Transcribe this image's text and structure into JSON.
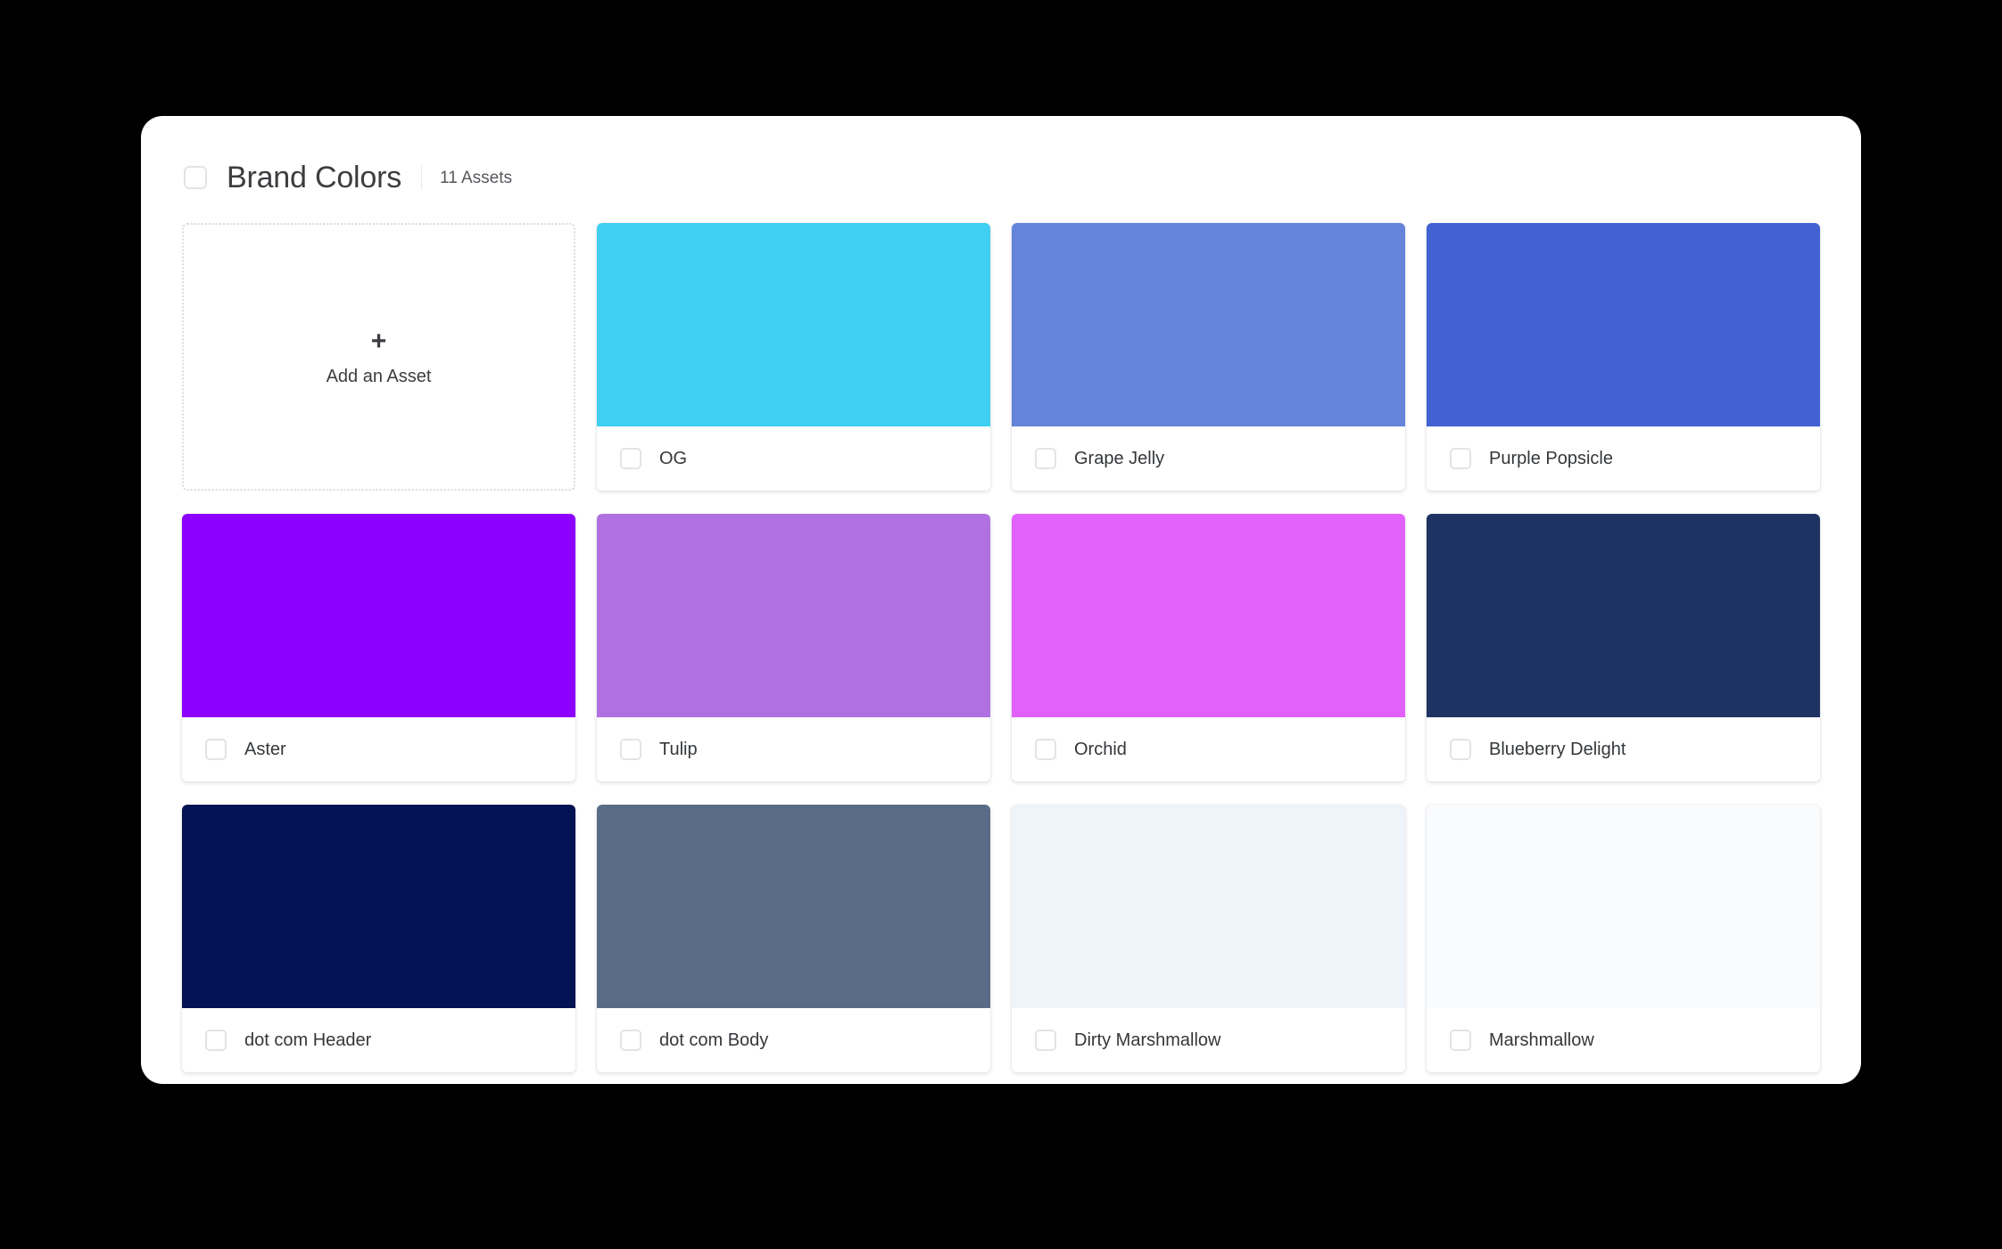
{
  "header": {
    "checkbox_name": "select-all-checkbox",
    "title": "Brand Colors",
    "asset_count": "11 Assets"
  },
  "add_tile": {
    "plus": "+",
    "label": "Add an Asset"
  },
  "assets": [
    {
      "name": "OG",
      "color": "#3ECFF2"
    },
    {
      "name": "Grape Jelly",
      "color": "#6584D9"
    },
    {
      "name": "Purple Popsicle",
      "color": "#4261D3"
    },
    {
      "name": "Aster",
      "color": "#8C00FF"
    },
    {
      "name": "Tulip",
      "color": "#B070E2"
    },
    {
      "name": "Orchid",
      "color": "#E261FC"
    },
    {
      "name": "Blueberry Delight",
      "color": "#1E3362"
    },
    {
      "name": "dot com Header",
      "color": "#021252"
    },
    {
      "name": "dot com Body",
      "color": "#5A6B87"
    },
    {
      "name": "Dirty Marshmallow",
      "color": "#EFF3FA"
    },
    {
      "name": "Marshmallow",
      "color": "#F9FBFD"
    }
  ],
  "theme": {
    "page_background": "#000000",
    "panel_background": "#FFFFFF",
    "text_primary": "#3B3D40",
    "checkbox_border": "#E2E4E7"
  }
}
